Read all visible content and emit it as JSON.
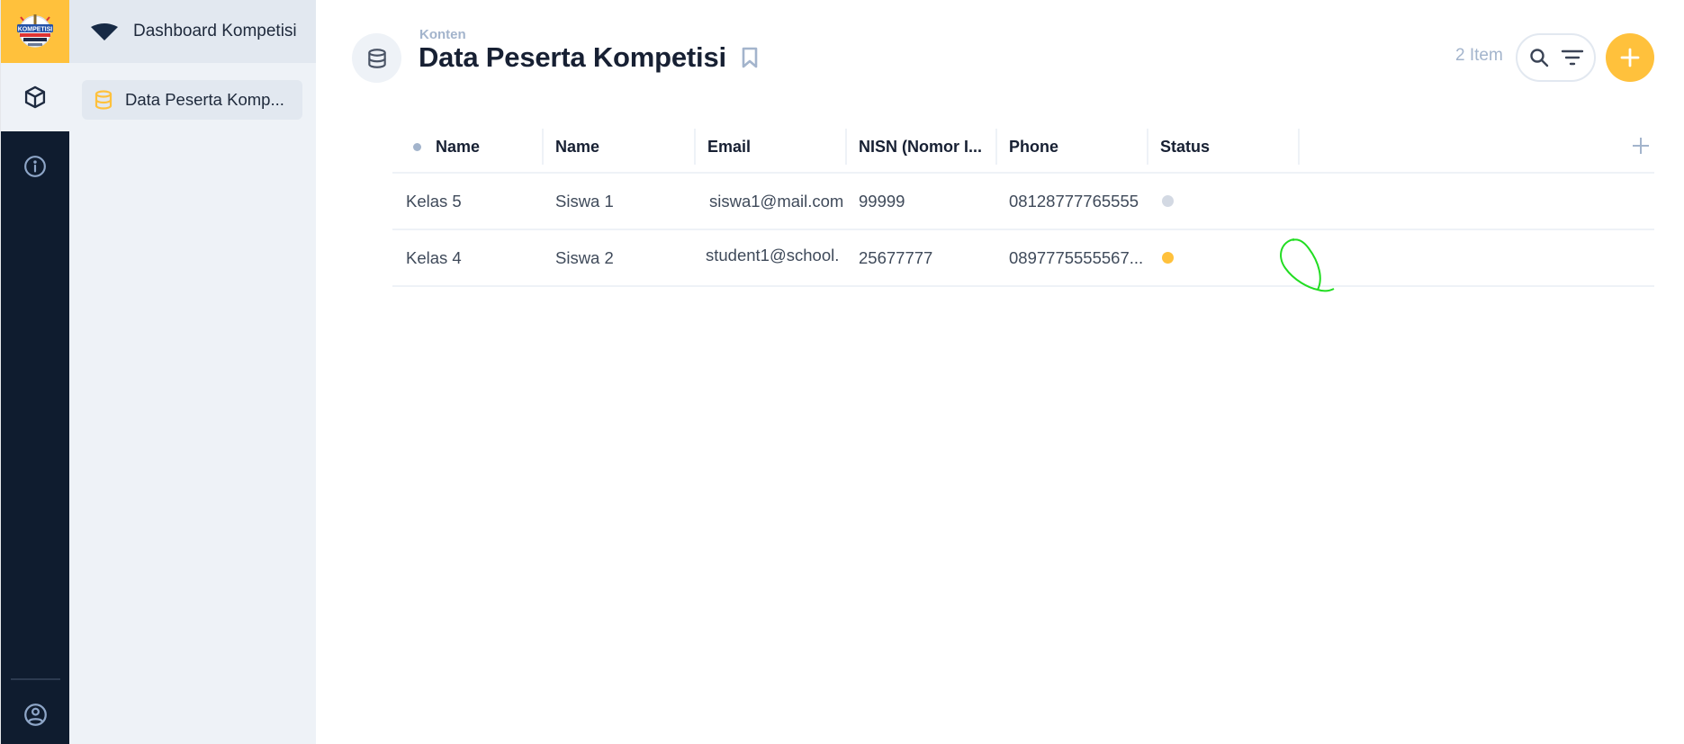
{
  "rail": {
    "logo_alt": "Kompetisi logo",
    "items": [
      {
        "icon": "cube-icon",
        "active": true
      },
      {
        "icon": "info-icon",
        "active": false
      }
    ],
    "bottom_icon": "user-circle-icon"
  },
  "sidebar": {
    "header": {
      "label": "Dashboard Kompetisi",
      "icon": "dashboard-wedge-icon"
    },
    "items": [
      {
        "label": "Data Peserta Komp...",
        "icon": "database-icon",
        "active": true
      }
    ]
  },
  "header": {
    "subtitle": "Konten",
    "title": "Data Peserta Kompetisi",
    "bookmark_icon": "bookmark-icon",
    "item_count": "2 Item",
    "search_icon": "search-icon",
    "filter_icon": "filter-icon",
    "add_icon": "plus-icon"
  },
  "table": {
    "columns": [
      "Name",
      "Name",
      "Email",
      "NISN (Nomor I...",
      "Phone",
      "Status"
    ],
    "rows": [
      {
        "cells": [
          "Kelas 5",
          "Siswa 1",
          "siswa1@mail.com",
          "99999",
          "08128777765555"
        ],
        "status": "inactive",
        "status_color": "#d3d9e3"
      },
      {
        "cells": [
          "Kelas 4",
          "Siswa 2",
          "student1@school.",
          "25677777",
          "0897775555567..."
        ],
        "status": "active",
        "status_color": "#ffc13c"
      }
    ]
  },
  "colors": {
    "accent": "#ffc13c",
    "rail_bg": "#0f1c2f",
    "sidebar_bg": "#eef2f7",
    "annotation": "#22dd22"
  }
}
